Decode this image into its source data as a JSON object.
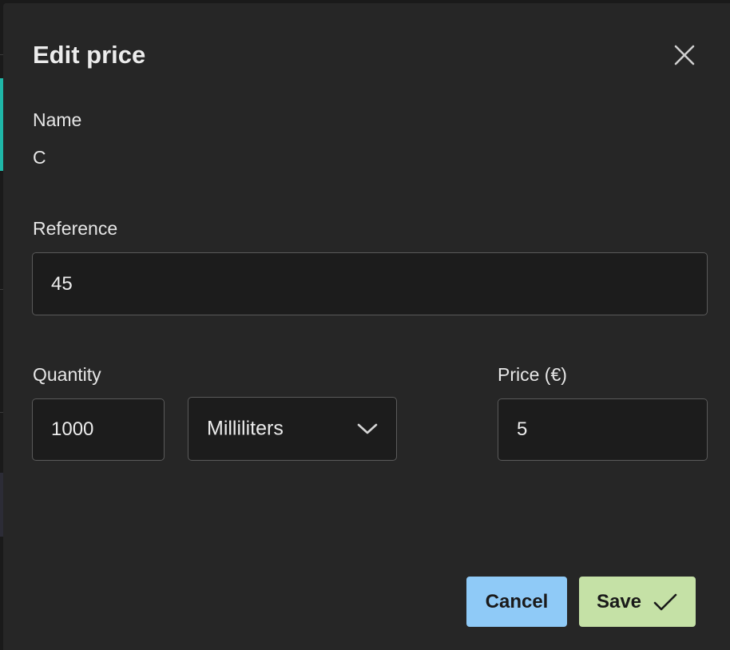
{
  "dialog": {
    "title": "Edit price",
    "close_icon": "close-icon"
  },
  "name_field": {
    "label": "Name",
    "value": "C"
  },
  "reference_field": {
    "label": "Reference",
    "value": "45"
  },
  "quantity_field": {
    "label": "Quantity",
    "value": "1000",
    "unit_selected": "Milliliters",
    "unit_icon": "chevron-down-icon"
  },
  "price_field": {
    "label": "Price (€)",
    "value": "5"
  },
  "actions": {
    "cancel_label": "Cancel",
    "save_label": "Save",
    "save_icon": "checkmark-icon"
  },
  "colors": {
    "dialog_background": "#262626",
    "input_background": "#1c1c1c",
    "input_border": "#5a5a5a",
    "cancel_button": "#8fcaf7",
    "save_button": "#c5e1a6",
    "accent_teal": "#1fb7a8"
  }
}
